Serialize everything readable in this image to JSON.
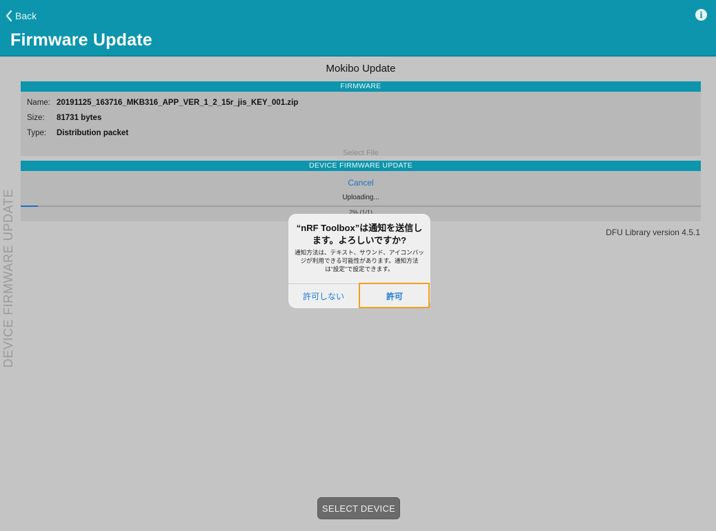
{
  "nav": {
    "back_label": "Back",
    "title": "Firmware Update",
    "info_icon": "info-icon"
  },
  "side_label": "DEVICE FIRMWARE UPDATE",
  "app_title": "Mokibo Update",
  "firmware": {
    "section_title": "FIRMWARE",
    "name_key": "Name:",
    "name_value": "20191125_163716_MKB316_APP_VER_1_2_15r_jis_KEY_001.zip",
    "size_key": "Size:",
    "size_value": "81731 bytes",
    "type_key": "Type:",
    "type_value": "Distribution packet",
    "select_file_label": "Select File"
  },
  "dfu": {
    "section_title": "DEVICE FIRMWARE UPDATE",
    "cancel_label": "Cancel",
    "status": "Uploading...",
    "progress_fraction": 0.025,
    "progress_label": "2% (1/1)",
    "library_version": "DFU Library version 4.5.1"
  },
  "alert": {
    "title": "“nRF Toolbox”は通知を送信します。よろしいですか?",
    "message": "通知方法は、テキスト、サウンド、アイコンバッジが利用できる可能性があります。通知方法は“設定”で設定できます。",
    "deny_label": "許可しない",
    "allow_label": "許可"
  },
  "bottom": {
    "select_device_label": "SELECT DEVICE"
  },
  "colors": {
    "header": "#0c95ac",
    "background": "#c4c4c4",
    "panel": "#b8b8b8",
    "link": "#1f6fbf",
    "alert_button": "#1b79d8",
    "highlight": "#f0a020"
  }
}
